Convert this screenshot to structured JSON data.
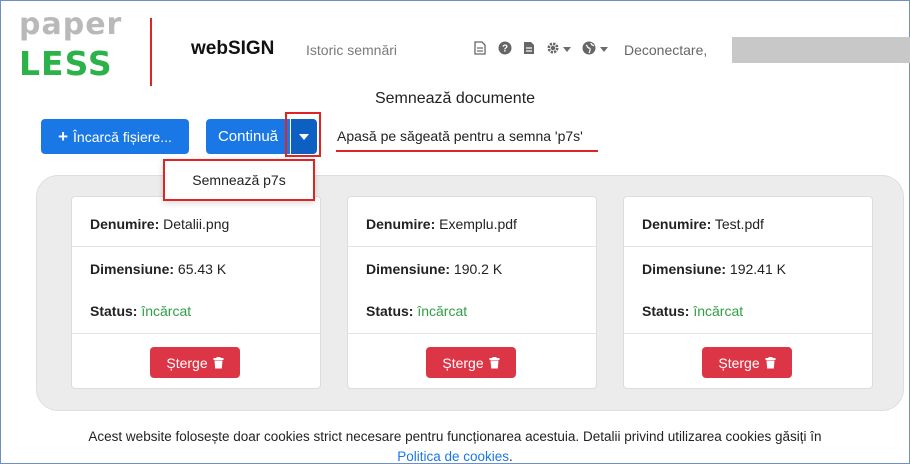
{
  "logo": {
    "top": "paper",
    "bottom": "LESS"
  },
  "nav": {
    "brand": "webSIGN",
    "history": "Istoric semnări",
    "logout": "Deconectare,"
  },
  "page": {
    "title": "Semnează documente"
  },
  "toolbar": {
    "upload_label": "Încarcă fișiere...",
    "continue_label": "Continuă",
    "hint": "Apasă pe săgeată pentru a semna 'p7s'"
  },
  "dropdown": {
    "item": "Semnează p7s"
  },
  "files": [
    {
      "name_label": "Denumire:",
      "name": "Detalii.png",
      "size_label": "Dimensiune:",
      "size": "65.43 K",
      "status_label": "Status:",
      "status": "încărcat",
      "delete_label": "Șterge"
    },
    {
      "name_label": "Denumire:",
      "name": "Exemplu.pdf",
      "size_label": "Dimensiune:",
      "size": "190.2 K",
      "status_label": "Status:",
      "status": "încărcat",
      "delete_label": "Șterge"
    },
    {
      "name_label": "Denumire:",
      "name": "Test.pdf",
      "size_label": "Dimensiune:",
      "size": "192.41 K",
      "status_label": "Status:",
      "status": "încărcat",
      "delete_label": "Șterge"
    }
  ],
  "footer": {
    "text": "Acest website folosește doar cookies strict necesare pentru funcționarea acestuia. Detalii privind utilizarea cookies găsiți în",
    "link": "Politica de cookies",
    "end": "."
  },
  "colors": {
    "primary": "#1a78e6",
    "danger": "#dc3545",
    "success": "#2f9e44",
    "highlight": "#e02424",
    "logo_green": "#2bb34a"
  },
  "icons": [
    "plus-icon",
    "caret-down-icon",
    "trash-icon",
    "document-icon",
    "help-icon",
    "file-icon",
    "gear-icon",
    "globe-icon"
  ]
}
